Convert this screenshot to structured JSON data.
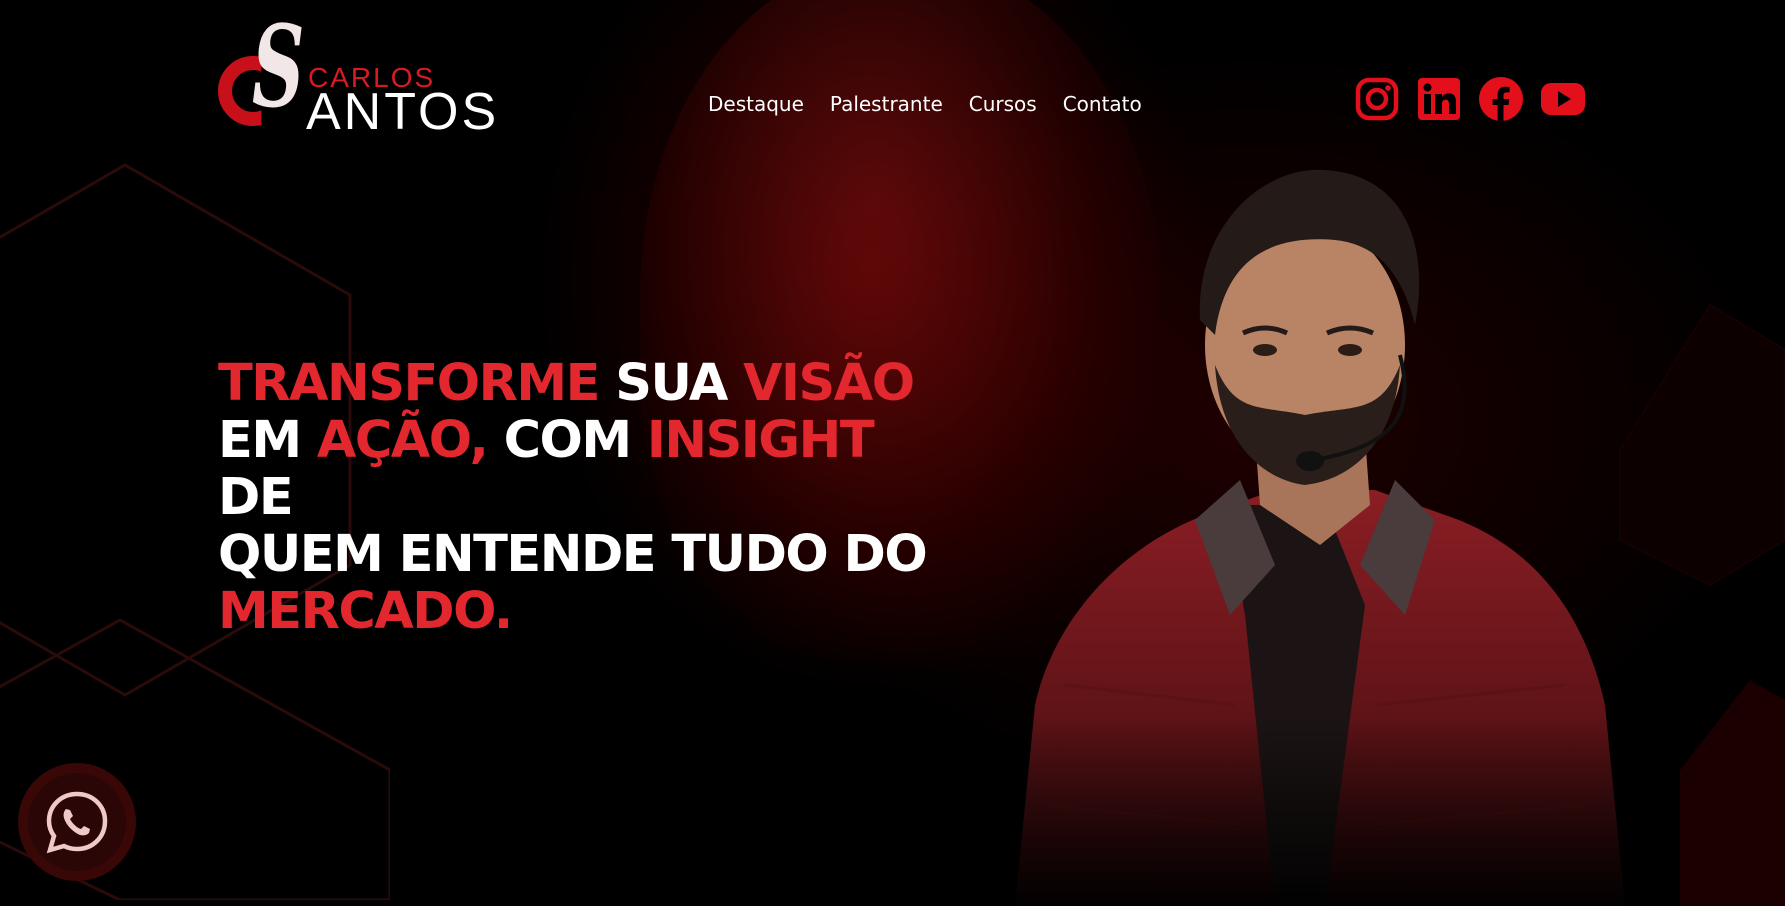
{
  "brand": {
    "logo_first": "Carlos",
    "logo_last": "Santos",
    "logo_last_rendered": "ANTOS",
    "logo_first_rendered": "CARLOS",
    "accent_color": "#e3272e",
    "dark_red": "#c8101b"
  },
  "nav": {
    "items": [
      "Destaque",
      "Palestrante",
      "Cursos",
      "Contato"
    ]
  },
  "social": {
    "icons": [
      "instagram-icon",
      "linkedin-icon",
      "facebook-icon",
      "youtube-icon"
    ],
    "icon_color": "#e3101c"
  },
  "hero": {
    "w1": "TRANSFORME",
    "w2": "SUA",
    "w3": "VISÃO",
    "w4": "EM",
    "w5": "AÇÃO,",
    "w6": "COM",
    "w7": "INSIGHT",
    "w8": "DE",
    "w9": "QUEM ENTENDE TUDO DO",
    "w10": "MERCADO."
  },
  "whatsapp": {
    "icon": "whatsapp-icon"
  }
}
